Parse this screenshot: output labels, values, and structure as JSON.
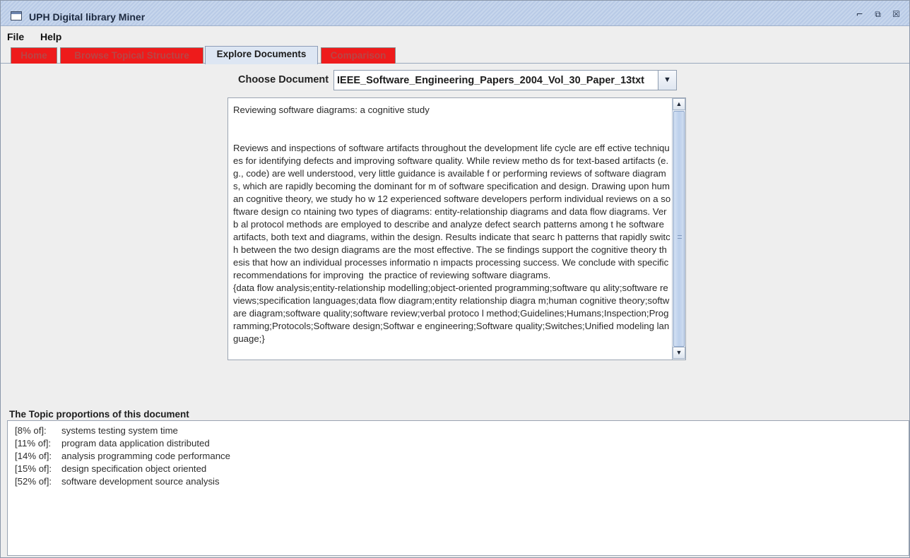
{
  "window": {
    "title": "UPH Digital library Miner",
    "controls": [
      "⌐",
      "⧉",
      "☒"
    ]
  },
  "menu": {
    "file": "File",
    "help": "Help"
  },
  "tabs": {
    "home": "Home",
    "browse": "Browse Topical Structure",
    "explore": "Explore Documents",
    "comparison": "Comparison",
    "active": "Explore Documents"
  },
  "chooser": {
    "label": "Choose Document",
    "selected": "IEEE_Software_Engineering_Papers_2004_Vol_30_Paper_13txt"
  },
  "document": {
    "text": "Reviewing software diagrams: a cognitive study\n\n\nReviews and inspections of software artifacts throughout the development life cycle are eff ective techniques for identifying defects and improving software quality. While review metho ds for text-based artifacts (e.g., code) are well understood, very little guidance is available f or performing reviews of software diagrams, which are rapidly becoming the dominant for m of software specification and design. Drawing upon human cognitive theory, we study ho w 12 experienced software developers perform individual reviews on a software design co ntaining two types of diagrams: entity-relationship diagrams and data flow diagrams. Verb al protocol methods are employed to describe and analyze defect search patterns among t he software artifacts, both text and diagrams, within the design. Results indicate that searc h patterns that rapidly switch between the two design diagrams are the most effective. The se findings support the cognitive theory thesis that how an individual processes informatio n impacts processing success. We conclude with specific recommendations for improving  the practice of reviewing software diagrams.\n{data flow analysis;entity-relationship modelling;object-oriented programming;software qu ality;software reviews;specification languages;data flow diagram;entity relationship diagra m;human cognitive theory;software diagram;software quality;software review;verbal protoco l method;Guidelines;Humans;Inspection;Programming;Protocols;Software design;Softwar e engineering;Software quality;Switches;Unified modeling language;}"
  },
  "topics": {
    "label": "The Topic proportions of this document",
    "rows": [
      {
        "pct": "[8% of]:",
        "terms": "systems testing system time"
      },
      {
        "pct": "[11% of]:",
        "terms": "program data application distributed"
      },
      {
        "pct": "[14% of]:",
        "terms": "analysis programming code performance"
      },
      {
        "pct": "[15% of]:",
        "terms": "design specification object oriented"
      },
      {
        "pct": "[52% of]:",
        "terms": "software development source analysis"
      }
    ]
  }
}
